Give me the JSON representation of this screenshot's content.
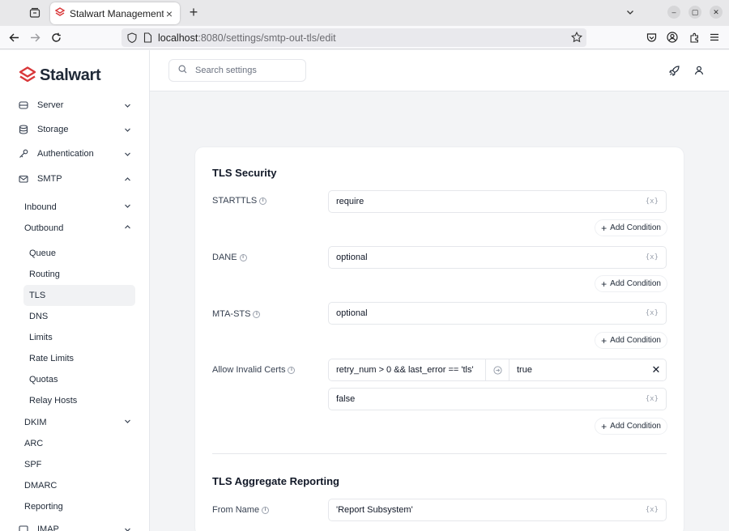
{
  "browser": {
    "tab_title": "Stalwart Management",
    "url_host": "localhost",
    "url_rest": ":8080/settings/smtp-out-tls/edit"
  },
  "app": {
    "logo_text": "Stalwart",
    "brand_color": "#d9383a",
    "search_placeholder": "Search settings"
  },
  "sidebar": {
    "sections": [
      {
        "label": "Server",
        "icon": "server-icon",
        "expanded": false
      },
      {
        "label": "Storage",
        "icon": "database-icon",
        "expanded": false
      },
      {
        "label": "Authentication",
        "icon": "key-icon",
        "expanded": false
      },
      {
        "label": "SMTP",
        "icon": "mail-icon",
        "expanded": true
      }
    ],
    "smtp_children": [
      {
        "label": "Inbound",
        "expanded": false
      },
      {
        "label": "Outbound",
        "expanded": true
      }
    ],
    "outbound_children": [
      "Queue",
      "Routing",
      "TLS",
      "DNS",
      "Limits",
      "Rate Limits",
      "Quotas",
      "Relay Hosts"
    ],
    "active_item": "TLS",
    "more_children": [
      {
        "label": "DKIM",
        "expandable": true
      },
      {
        "label": "ARC",
        "expandable": false
      },
      {
        "label": "SPF",
        "expandable": false
      },
      {
        "label": "DMARC",
        "expandable": false
      },
      {
        "label": "Reporting",
        "expandable": false
      },
      {
        "label": "IMAP",
        "expandable": true
      }
    ]
  },
  "form": {
    "tls_section_title": "TLS Security",
    "add_condition_label": "Add Condition",
    "fields": {
      "starttls": {
        "label": "STARTTLS",
        "value": "require"
      },
      "dane": {
        "label": "DANE",
        "value": "optional"
      },
      "mta_sts": {
        "label": "MTA-STS",
        "value": "optional"
      },
      "allow_invalid": {
        "label": "Allow Invalid Certs",
        "condition_if": "retry_num > 0 && last_error == 'tls'",
        "condition_then": "true",
        "default_value": "false"
      }
    },
    "report_section_title": "TLS Aggregate Reporting",
    "from_name": {
      "label": "From Name",
      "value": "'Report Subsystem'"
    }
  }
}
